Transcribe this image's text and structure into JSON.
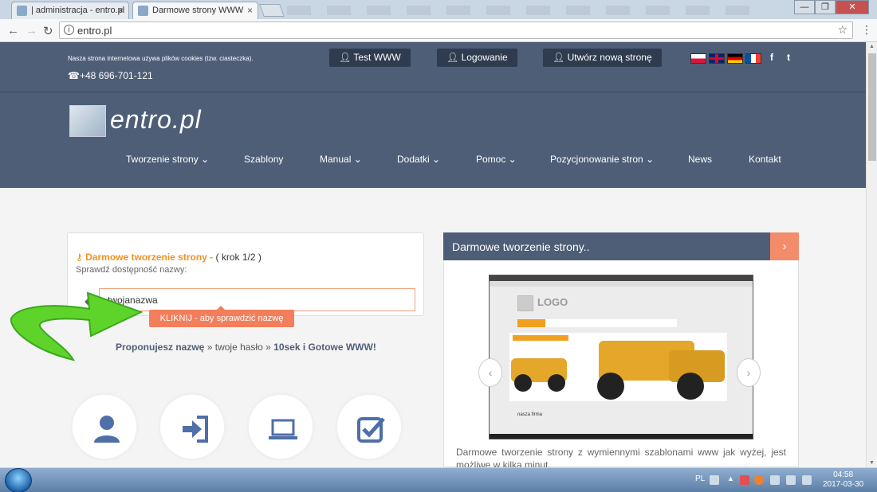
{
  "browser": {
    "tabs": [
      {
        "label": "| administracja - entro.pl"
      },
      {
        "label": "Darmowe strony WWW"
      }
    ],
    "url": "entro.pl",
    "win_min": "—",
    "win_max": "❐",
    "win_close": "✕"
  },
  "site": {
    "cookie_notice": "Nasza strona internetowa używa plików cookies (tzw. ciasteczka).",
    "phone": "+48 696-701-121",
    "top_buttons": {
      "test": "Test WWW",
      "login": "Logowanie",
      "create": "Utwórz nową stronę"
    },
    "social": {
      "facebook": "f",
      "twitter": "t"
    },
    "logo_text": "entro.pl",
    "nav": [
      {
        "label": "Tworzenie strony ⌄"
      },
      {
        "label": "Szablony"
      },
      {
        "label": "Manual ⌄"
      },
      {
        "label": "Dodatki ⌄"
      },
      {
        "label": "Pomoc ⌄"
      },
      {
        "label": "Pozycjonowanie stron ⌄"
      },
      {
        "label": "News"
      },
      {
        "label": "Kontakt"
      }
    ]
  },
  "form": {
    "title": "Darmowe tworzenie strony -",
    "step": "( krok 1/2 )",
    "subtitle": "Sprawdź dostępność nazwy:",
    "name_value": "twojanazwa",
    "tooltip": "KLIKNIJ - aby sprawdzić nazwę",
    "steps_a": "Proponujesz nazwę",
    "steps_sep1": "»",
    "steps_b": "twoje hasło",
    "steps_sep2": "»",
    "steps_c": "10sek i Gotowe WWW!"
  },
  "right_panel": {
    "heading": "Darmowe tworzenie strony..",
    "arrow": "›",
    "shot_logo": "LOGO",
    "shot_firm": "nasza firma",
    "prev": "‹",
    "next": "›",
    "description": "Darmowe tworzenie strony z wymiennymi szablonami www jak wyżej, jest możliwe w kilka minut."
  },
  "taskbar": {
    "lang": "PL",
    "time": "04:58",
    "date": "2017-03-30"
  },
  "colors": {
    "header": "#4e5e77",
    "accent_orange": "#f39022",
    "tooltip": "#f27e5b"
  }
}
